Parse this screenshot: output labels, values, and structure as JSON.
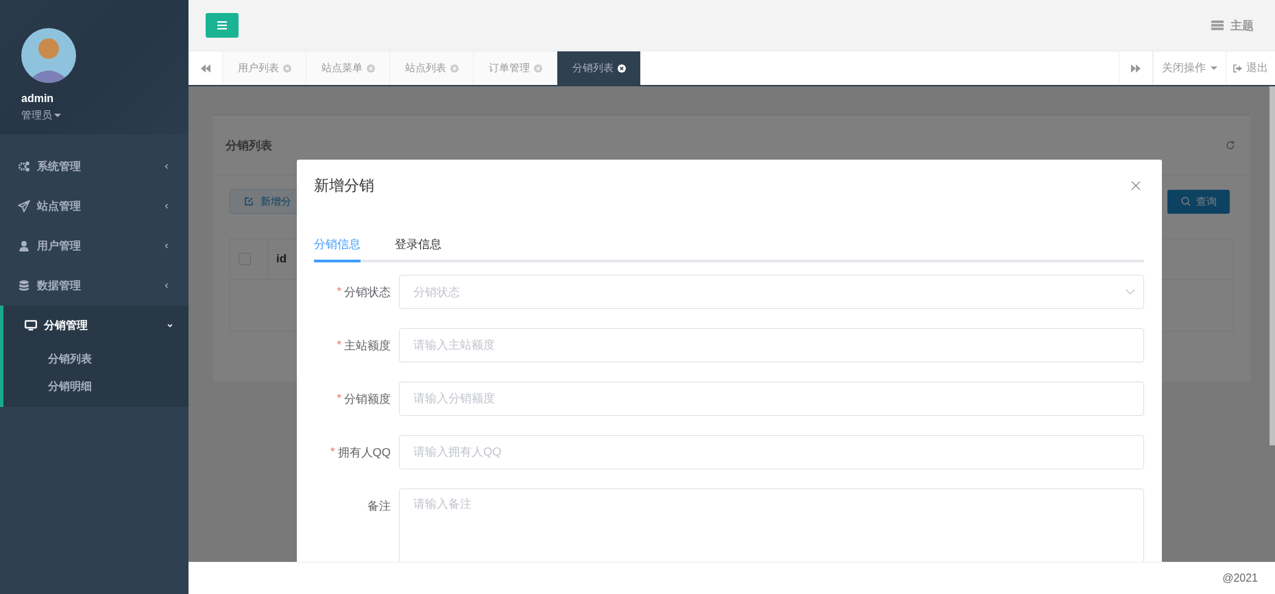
{
  "sidebar": {
    "user": {
      "name": "admin",
      "role": "管理员"
    },
    "menu": [
      {
        "label": "系统管理",
        "expanded": false
      },
      {
        "label": "站点管理",
        "expanded": false
      },
      {
        "label": "用户管理",
        "expanded": false
      },
      {
        "label": "数据管理",
        "expanded": false
      },
      {
        "label": "分销管理",
        "expanded": true,
        "children": [
          {
            "label": "分销列表"
          },
          {
            "label": "分销明细"
          }
        ]
      }
    ]
  },
  "topbar": {
    "theme": "主题"
  },
  "tabs": {
    "items": [
      {
        "label": "用户列表",
        "selected": false
      },
      {
        "label": "站点菜单",
        "selected": false
      },
      {
        "label": "站点列表",
        "selected": false
      },
      {
        "label": "订单管理",
        "selected": false
      },
      {
        "label": "分销列表",
        "selected": true
      }
    ],
    "close_ops": "关闭操作",
    "logout": "退出"
  },
  "page": {
    "title": "分销列表",
    "add_button": "新增分",
    "query_button": "查询",
    "table": {
      "select_all_checked": false,
      "columns": [
        "id"
      ]
    }
  },
  "modal": {
    "title": "新增分销",
    "tabs": [
      {
        "label": "分销信息",
        "selected": true
      },
      {
        "label": "登录信息",
        "selected": false
      }
    ],
    "fields": [
      {
        "mark": "*",
        "label": "分销状态",
        "kind": "select",
        "placeholder": "分销状态"
      },
      {
        "mark": "*",
        "label": "主站额度",
        "kind": "input",
        "placeholder": "请输入主站额度"
      },
      {
        "mark": "*",
        "label": "分销额度",
        "kind": "input",
        "placeholder": "请输入分销额度"
      },
      {
        "mark": "*",
        "label": "拥有人QQ",
        "kind": "input",
        "placeholder": "请输入拥有人QQ"
      },
      {
        "label": "备注",
        "kind": "textarea",
        "placeholder": "请输入备注"
      }
    ]
  },
  "footer": {
    "text": "@2021"
  }
}
